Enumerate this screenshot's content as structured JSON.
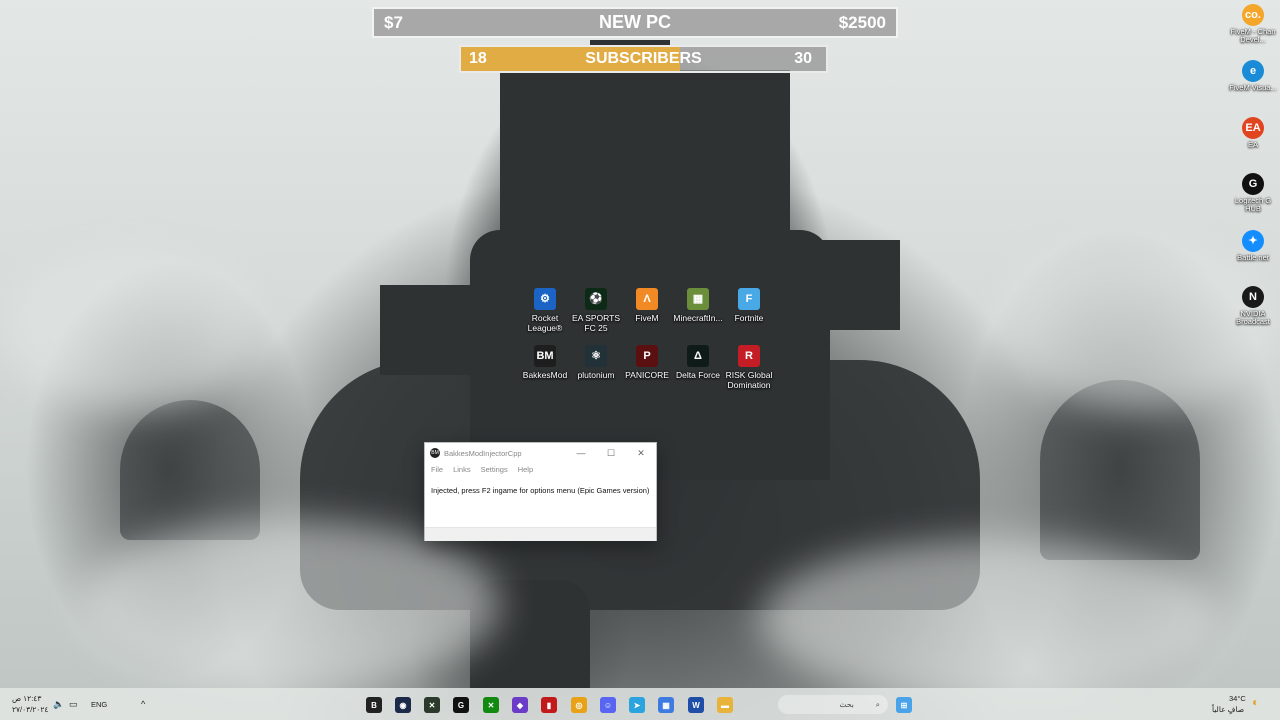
{
  "overlay": {
    "goal": {
      "left": "$7",
      "title": "NEW PC",
      "right": "$2500"
    },
    "subscribers": {
      "left": "18",
      "title": "SUBSCRIBERS",
      "right": "30",
      "progress": 0.6
    }
  },
  "desktop_icons": [
    {
      "label": "Rocket League®",
      "icon": "rocket-league-icon",
      "color": "#1b64c5",
      "glyph": "⚙"
    },
    {
      "label": "EA SPORTS FC 25",
      "icon": "ea-fc-icon",
      "color": "#0c2a15",
      "glyph": "⚽"
    },
    {
      "label": "FiveM",
      "icon": "fivem-icon",
      "color": "#f18a25",
      "glyph": "Λ"
    },
    {
      "label": "MinecraftIn...",
      "icon": "minecraft-icon",
      "color": "#6b8e3a",
      "glyph": "▦"
    },
    {
      "label": "Fortnite",
      "icon": "fortnite-icon",
      "color": "#49a8e6",
      "glyph": "F"
    },
    {
      "label": "BakkesMod",
      "icon": "bakkesmod-icon",
      "color": "#1e1e1e",
      "glyph": "BM"
    },
    {
      "label": "plutonium",
      "icon": "plutonium-icon",
      "color": "#223038",
      "glyph": "⚛"
    },
    {
      "label": "PANICORE",
      "icon": "panicore-icon",
      "color": "#5a1010",
      "glyph": "P"
    },
    {
      "label": "Delta Force",
      "icon": "delta-force-icon",
      "color": "#0e1b18",
      "glyph": "Δ"
    },
    {
      "label": "RISK Global Domination",
      "icon": "risk-icon",
      "color": "#c41d25",
      "glyph": "R"
    }
  ],
  "right_icons": [
    {
      "label": "FiveM - Chan Devel...",
      "icon": "fivem-shortcut-icon",
      "color": "#f4a62a",
      "glyph": "co."
    },
    {
      "label": "FiveM Visua...",
      "icon": "edge-icon",
      "color": "#1a8bd6",
      "glyph": "e"
    },
    {
      "label": "EA",
      "icon": "ea-icon",
      "color": "#e0451f",
      "glyph": "EA"
    },
    {
      "label": "Logitech G HUB",
      "icon": "logitech-icon",
      "color": "#111111",
      "glyph": "G"
    },
    {
      "label": "Battle.net",
      "icon": "battlenet-icon",
      "color": "#148eff",
      "glyph": "✦"
    },
    {
      "label": "NVIDIA Broadcast",
      "icon": "nvidia-icon",
      "color": "#1a1a1a",
      "glyph": "N"
    }
  ],
  "window": {
    "title": "BakkesModInjectorCpp",
    "app_glyph": "BM",
    "menu": [
      "File",
      "Links",
      "Settings",
      "Help"
    ],
    "message": "Injected, press F2 ingame for options menu (Epic Games version)",
    "controls": {
      "minimize": "—",
      "maximize": "☐",
      "close": "✕"
    }
  },
  "taskbar": {
    "clock_time": "١٢:٤٣ ص",
    "clock_date": "٢٧/٠٣/٢٠٢٤",
    "language": "ENG",
    "search_placeholder": "بحث",
    "weather_temp": "34°C",
    "weather_desc": "صافٍ عالياً",
    "items": [
      {
        "icon": "bakkesmod-taskbar-icon",
        "color": "#222222",
        "glyph": "B"
      },
      {
        "icon": "app-taskbar-icon",
        "color": "#1c2a4a",
        "glyph": "◉"
      },
      {
        "icon": "terminal-taskbar-icon",
        "color": "#2b3a2b",
        "glyph": "✕"
      },
      {
        "icon": "logitech-taskbar-icon",
        "color": "#111111",
        "glyph": "G"
      },
      {
        "icon": "xbox-taskbar-icon",
        "color": "#128a12",
        "glyph": "✕"
      },
      {
        "icon": "gamepad-taskbar-icon",
        "color": "#6a3cc7",
        "glyph": "◆"
      },
      {
        "icon": "red-app-taskbar-icon",
        "color": "#c21a1a",
        "glyph": "▮"
      },
      {
        "icon": "chrome-taskbar-icon",
        "color": "#e8a218",
        "glyph": "◎"
      },
      {
        "icon": "discord-taskbar-icon",
        "color": "#5865f2",
        "glyph": "☺"
      },
      {
        "icon": "telegram-taskbar-icon",
        "color": "#2aa3df",
        "glyph": "➤"
      },
      {
        "icon": "store-taskbar-icon",
        "color": "#3d7be0",
        "glyph": "▦"
      },
      {
        "icon": "word-taskbar-icon",
        "color": "#1f4ea8",
        "glyph": "W"
      },
      {
        "icon": "explorer-taskbar-icon",
        "color": "#e7b33a",
        "glyph": "▬"
      }
    ]
  }
}
